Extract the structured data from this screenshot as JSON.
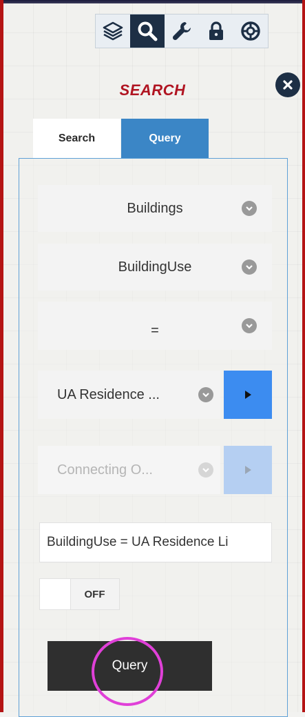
{
  "toolbar": {
    "icons": [
      "layers-icon",
      "search-icon",
      "wrench-icon",
      "lock-icon",
      "lifebuoy-icon"
    ],
    "active": "search-icon"
  },
  "panel": {
    "title": "SEARCH"
  },
  "tabs": {
    "search_label": "Search",
    "query_label": "Query"
  },
  "query_form": {
    "layer": "Buildings",
    "field": "BuildingUse",
    "operator": "=",
    "value": "UA Residence ...",
    "connector_placeholder": "Connecting O...",
    "expression": "BuildingUse = UA Residence Li",
    "toggle_label": "OFF",
    "submit_label": "Query"
  },
  "colors": {
    "accent_blue": "#3c8cf0",
    "tab_active": "#3b86c6",
    "title_red": "#b01421",
    "frame_red": "#b41414",
    "highlight_magenta": "#e040d8",
    "dark_button": "#2f2f2f"
  }
}
